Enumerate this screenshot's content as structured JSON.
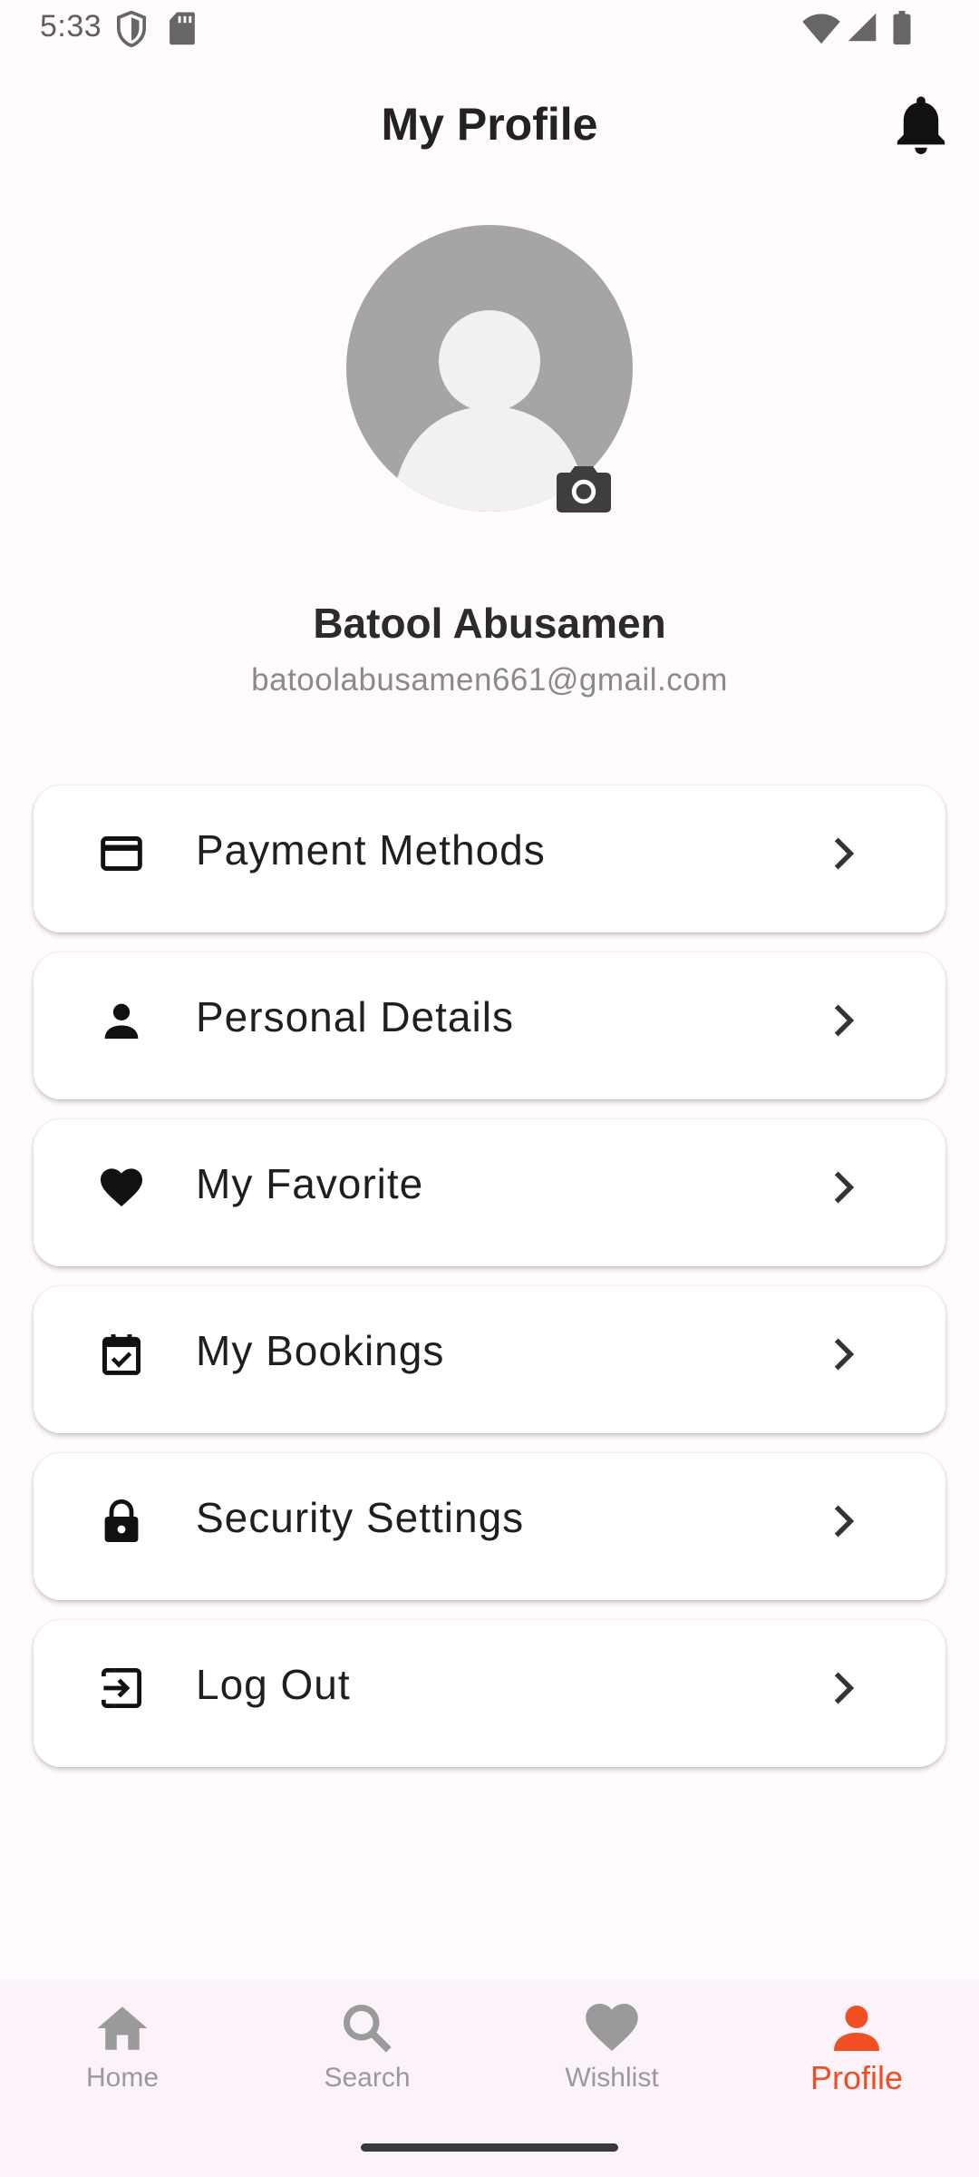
{
  "status_bar": {
    "time": "5:33",
    "icons": [
      "shield-icon",
      "sd-card-icon",
      "wifi-icon",
      "cell-signal-icon",
      "battery-icon"
    ]
  },
  "header": {
    "title": "My Profile",
    "notification_icon": "bell-icon"
  },
  "profile": {
    "avatar_icon": "default-avatar-icon",
    "camera_icon": "camera-icon",
    "name": "Batool Abusamen",
    "email": "batoolabusamen661@gmail.com"
  },
  "menu": {
    "items": [
      {
        "label": "Payment Methods",
        "icon": "credit-card-icon"
      },
      {
        "label": "Personal Details",
        "icon": "person-icon"
      },
      {
        "label": "My Favorite",
        "icon": "heart-icon"
      },
      {
        "label": "My Bookings",
        "icon": "calendar-check-icon"
      },
      {
        "label": "Security Settings",
        "icon": "lock-icon"
      },
      {
        "label": "Log Out",
        "icon": "logout-icon"
      }
    ],
    "chevron_icon": "chevron-right-icon"
  },
  "bottom_nav": {
    "items": [
      {
        "label": "Home",
        "icon": "home-icon",
        "active": false
      },
      {
        "label": "Search",
        "icon": "search-icon",
        "active": false
      },
      {
        "label": "Wishlist",
        "icon": "heart-icon",
        "active": false
      },
      {
        "label": "Profile",
        "icon": "person-icon",
        "active": true
      }
    ]
  },
  "colors": {
    "accent": "#f04e23",
    "nav_background": "#fbf2fa",
    "inactive_nav": "#9a9a9a",
    "avatar_background": "#a5a5a5",
    "page_background": "#fffbfe"
  }
}
